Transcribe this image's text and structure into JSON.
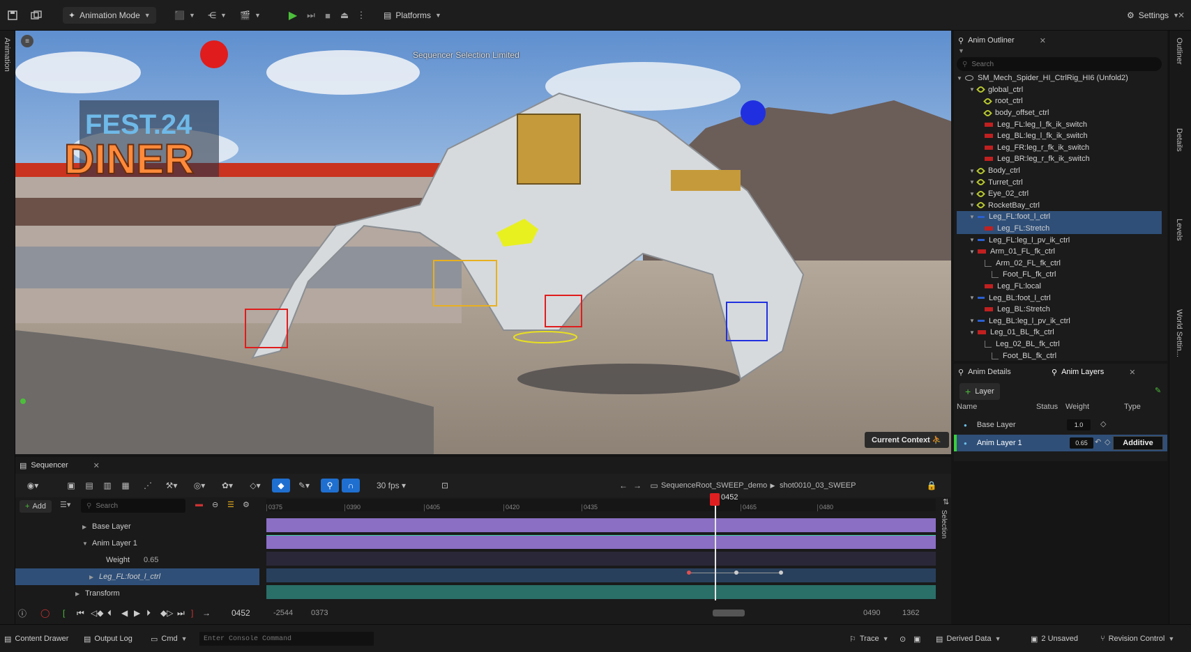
{
  "toolbar": {
    "mode_label": "Animation Mode",
    "platforms_label": "Platforms",
    "settings_label": "Settings"
  },
  "left_tab": {
    "label": "Animation"
  },
  "right_tabs": {
    "outliner": "Outliner",
    "details": "Details",
    "levels": "Levels",
    "world_settings": "World Settin..."
  },
  "viewport": {
    "banner": "Sequencer Selection Limited",
    "current_context": "Current Context",
    "sign_top": "FEST.24",
    "sign_bottom": "DINER"
  },
  "outliner": {
    "tab_label": "Anim Outliner",
    "search_placeholder": "Search",
    "root": "SM_Mech_Spider_HI_CtrlRig_HI6 (Unfold2)",
    "items": [
      {
        "label": "global_ctrl",
        "icon": "leaf",
        "level": 1
      },
      {
        "label": "root_ctrl",
        "icon": "leaf",
        "level": 2
      },
      {
        "label": "body_offset_ctrl",
        "icon": "leaf",
        "level": 2
      },
      {
        "label": "Leg_FL:leg_l_fk_ik_switch",
        "icon": "red",
        "level": 2
      },
      {
        "label": "Leg_BL:leg_l_fk_ik_switch",
        "icon": "red",
        "level": 2
      },
      {
        "label": "Leg_FR:leg_r_fk_ik_switch",
        "icon": "red",
        "level": 2
      },
      {
        "label": "Leg_BR:leg_r_fk_ik_switch",
        "icon": "red",
        "level": 2
      },
      {
        "label": "Body_ctrl",
        "icon": "leaf",
        "level": 1
      },
      {
        "label": "Turret_ctrl",
        "icon": "leaf",
        "level": 1
      },
      {
        "label": "Eye_02_ctrl",
        "icon": "leaf",
        "level": 1
      },
      {
        "label": "RocketBay_ctrl",
        "icon": "leaf",
        "level": 1
      },
      {
        "label": "Leg_FL:foot_l_ctrl",
        "icon": "blue",
        "level": 1,
        "selected": true
      },
      {
        "label": "Leg_FL:Stretch",
        "icon": "red",
        "level": 2,
        "selected": true
      },
      {
        "label": "Leg_FL:leg_l_pv_ik_ctrl",
        "icon": "blue",
        "level": 1
      },
      {
        "label": "Arm_01_FL_fk_ctrl",
        "icon": "red",
        "level": 1
      },
      {
        "label": "Arm_02_FL_fk_ctrl",
        "icon": "none",
        "level": 2
      },
      {
        "label": "Foot_FL_fk_ctrl",
        "icon": "none",
        "level": 3
      },
      {
        "label": "Leg_FL:local",
        "icon": "red",
        "level": 2
      },
      {
        "label": "Leg_BL:foot_l_ctrl",
        "icon": "blue",
        "level": 1
      },
      {
        "label": "Leg_BL:Stretch",
        "icon": "red",
        "level": 2
      },
      {
        "label": "Leg_BL:leg_l_pv_ik_ctrl",
        "icon": "blue",
        "level": 1
      },
      {
        "label": "Leg_01_BL_fk_ctrl",
        "icon": "red",
        "level": 1
      },
      {
        "label": "Leg_02_BL_fk_ctrl",
        "icon": "none",
        "level": 2
      },
      {
        "label": "Foot_BL_fk_ctrl",
        "icon": "none",
        "level": 3
      }
    ]
  },
  "anim_layers": {
    "details_tab": "Anim Details",
    "layers_tab": "Anim Layers",
    "add_label": "Layer",
    "columns": {
      "name": "Name",
      "status": "Status",
      "weight": "Weight",
      "type": "Type"
    },
    "rows": [
      {
        "name": "Base Layer",
        "weight": "1.0",
        "type": ""
      },
      {
        "name": "Anim Layer 1",
        "weight": "0.65",
        "type": "Additive"
      }
    ]
  },
  "sequencer": {
    "tab_label": "Sequencer",
    "fps_label": "30 fps",
    "breadcrumb_root": "SequenceRoot_SWEEP_demo",
    "breadcrumb_shot": "shot0010_03_SWEEP",
    "add_label": "Add",
    "search_placeholder": "Search",
    "current_frame": "0452",
    "side_label": "Selection",
    "ruler_ticks": [
      "0375",
      "0390",
      "0405",
      "0420",
      "0435",
      "0465",
      "0480"
    ],
    "tracks": [
      {
        "label": "Base Layer",
        "value": ""
      },
      {
        "label": "Anim Layer 1",
        "value": ""
      },
      {
        "label": "Weight",
        "value": "0.65"
      },
      {
        "label": "Leg_FL:foot_l_ctrl",
        "value": ""
      },
      {
        "label": "Transform",
        "value": ""
      }
    ],
    "bottom": {
      "frame": "0452",
      "start": "-2544",
      "in": "0373",
      "out": "0490",
      "end": "1362"
    }
  },
  "statusbar": {
    "content_drawer": "Content Drawer",
    "output_log": "Output Log",
    "cmd": "Cmd",
    "console_placeholder": "Enter Console Command",
    "trace": "Trace",
    "derived_data": "Derived Data",
    "unsaved": "2 Unsaved",
    "revision_control": "Revision Control"
  }
}
